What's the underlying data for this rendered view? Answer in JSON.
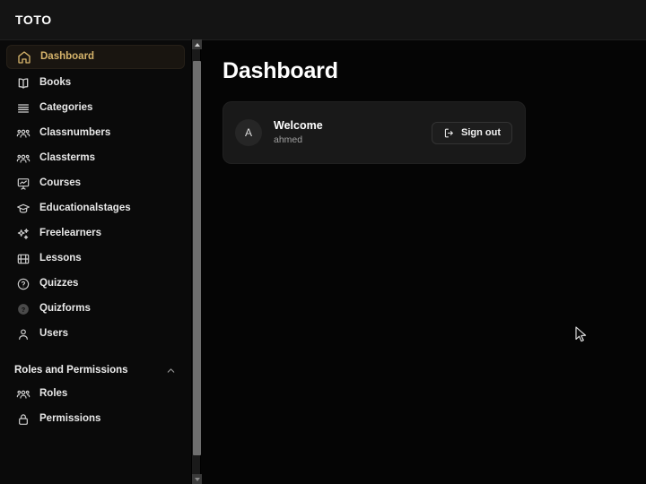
{
  "brand": {
    "name": "TOTO"
  },
  "sidebar": {
    "items": [
      {
        "label": "Dashboard",
        "icon": "home-icon",
        "active": true
      },
      {
        "label": "Books",
        "icon": "book-icon",
        "active": false
      },
      {
        "label": "Categories",
        "icon": "list-icon",
        "active": false
      },
      {
        "label": "Classnumbers",
        "icon": "users-group-icon",
        "active": false
      },
      {
        "label": "Classterms",
        "icon": "users-group-icon",
        "active": false
      },
      {
        "label": "Courses",
        "icon": "presentation-chart-icon",
        "active": false
      },
      {
        "label": "Educationalstages",
        "icon": "graduation-cap-icon",
        "active": false
      },
      {
        "label": "Freelearners",
        "icon": "sparkles-icon",
        "active": false
      },
      {
        "label": "Lessons",
        "icon": "film-strip-icon",
        "active": false
      },
      {
        "label": "Quizzes",
        "icon": "question-circle-icon",
        "active": false
      },
      {
        "label": "Quizforms",
        "icon": "question-circle-filled-icon",
        "active": false
      },
      {
        "label": "Users",
        "icon": "user-icon",
        "active": false
      }
    ],
    "group": {
      "label": "Roles and Permissions",
      "chevron": "chevron-up-icon",
      "items": [
        {
          "label": "Roles",
          "icon": "users-group-icon",
          "active": false
        },
        {
          "label": "Permissions",
          "icon": "lock-icon",
          "active": false
        }
      ]
    }
  },
  "main": {
    "title": "Dashboard",
    "card": {
      "avatar_initial": "A",
      "welcome_title": "Welcome",
      "username": "ahmed",
      "signout_label": "Sign out",
      "signout_icon": "logout-icon"
    }
  },
  "colors": {
    "accent": "#d6b46b",
    "background": "#050505",
    "sidebar": "#0a0a0a",
    "topbar": "#141414",
    "card": "#191919",
    "text": "#ffffff",
    "muted": "#a0a0a0"
  }
}
